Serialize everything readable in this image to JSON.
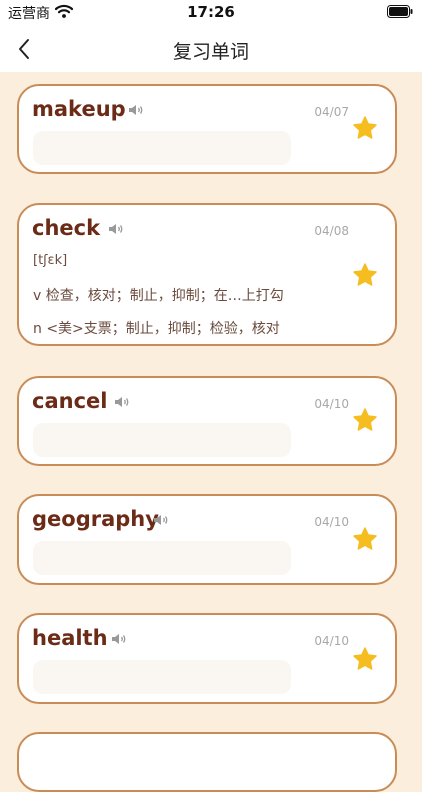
{
  "status_bar": {
    "carrier": "运营商",
    "time": "17:26"
  },
  "nav": {
    "title": "复习单词"
  },
  "cards": [
    {
      "word": "makeup",
      "date": "04/07"
    },
    {
      "word": "check",
      "date": "04/08",
      "phonetic": "[tʃɛk]",
      "definitions": [
        "v 检查，核对；制止，抑制；在…上打勾",
        "n <美>支票；制止，抑制；检验，核对"
      ]
    },
    {
      "word": "cancel",
      "date": "04/10"
    },
    {
      "word": "geography",
      "date": "04/10"
    },
    {
      "word": "health",
      "date": "04/10"
    }
  ],
  "colors": {
    "accent_border": "#c98c57",
    "word_text": "#6b2b17",
    "star": "#f5bd1f",
    "page_bg": "#fbeedd"
  }
}
